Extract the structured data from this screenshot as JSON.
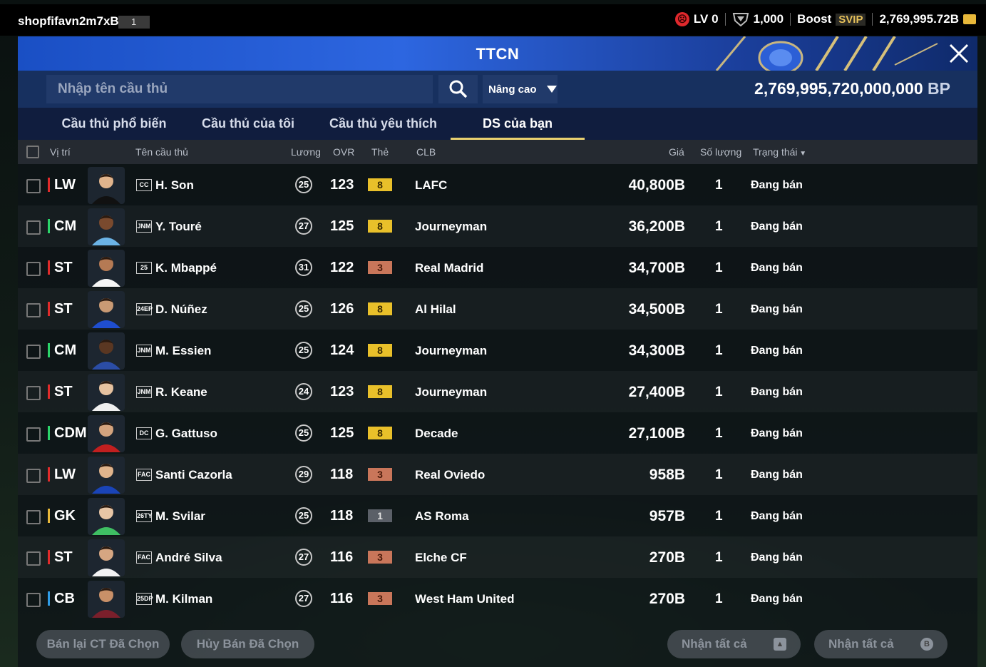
{
  "topbar": {
    "account_name": "shopfifavn2m7xBp",
    "account_badge": "1",
    "level": "LV 0",
    "fc_points": "1,000",
    "boost_label": "Boost",
    "svip_label": "SVIP",
    "bp_short": "2,769,995.72B"
  },
  "window": {
    "title": "TTCN"
  },
  "search": {
    "placeholder": "Nhập tên cầu thủ",
    "advanced_label": "Nâng cao",
    "bp_amount": "2,769,995,720,000,000",
    "bp_unit": "BP"
  },
  "tabs": [
    {
      "label": "Cầu thủ phổ biến",
      "active": false
    },
    {
      "label": "Cầu thủ của tôi",
      "active": false
    },
    {
      "label": "Cầu thủ yêu thích",
      "active": false
    },
    {
      "label": "DS của bạn",
      "active": true
    }
  ],
  "columns": {
    "position": "Vị trí",
    "name": "Tên cầu thủ",
    "salary": "Lương",
    "ovr": "OVR",
    "card": "Thẻ",
    "club": "CLB",
    "price": "Giá",
    "quantity": "Số lượng",
    "status": "Trạng thái"
  },
  "players": [
    {
      "pos": "LW",
      "season": "CC",
      "name": "H. Son",
      "salary": "25",
      "ovr": "123",
      "upgrade": "8",
      "club": "LAFC",
      "price": "40,800B",
      "qty": "1",
      "status": "Đang bán"
    },
    {
      "pos": "CM",
      "season": "JNM",
      "name": "Y. Touré",
      "salary": "27",
      "ovr": "125",
      "upgrade": "8",
      "club": "Journeyman",
      "price": "36,200B",
      "qty": "1",
      "status": "Đang bán"
    },
    {
      "pos": "ST",
      "season": "25",
      "name": "K. Mbappé",
      "salary": "31",
      "ovr": "122",
      "upgrade": "3",
      "club": "Real Madrid",
      "price": "34,700B",
      "qty": "1",
      "status": "Đang bán"
    },
    {
      "pos": "ST",
      "season": "24EP",
      "name": "D. Núñez",
      "salary": "25",
      "ovr": "126",
      "upgrade": "8",
      "club": "Al Hilal",
      "price": "34,500B",
      "qty": "1",
      "status": "Đang bán"
    },
    {
      "pos": "CM",
      "season": "JNM",
      "name": "M. Essien",
      "salary": "25",
      "ovr": "124",
      "upgrade": "8",
      "club": "Journeyman",
      "price": "34,300B",
      "qty": "1",
      "status": "Đang bán"
    },
    {
      "pos": "ST",
      "season": "JNM",
      "name": "R. Keane",
      "salary": "24",
      "ovr": "123",
      "upgrade": "8",
      "club": "Journeyman",
      "price": "27,400B",
      "qty": "1",
      "status": "Đang bán"
    },
    {
      "pos": "CDM",
      "season": "DC",
      "name": "G. Gattuso",
      "salary": "25",
      "ovr": "125",
      "upgrade": "8",
      "club": "Decade",
      "price": "27,100B",
      "qty": "1",
      "status": "Đang bán"
    },
    {
      "pos": "LW",
      "season": "FAC",
      "name": "Santi Cazorla",
      "salary": "29",
      "ovr": "118",
      "upgrade": "3",
      "club": "Real Oviedo",
      "price": "958B",
      "qty": "1",
      "status": "Đang bán"
    },
    {
      "pos": "GK",
      "season": "26TY",
      "name": "M. Svilar",
      "salary": "25",
      "ovr": "118",
      "upgrade": "1",
      "club": "AS Roma",
      "price": "957B",
      "qty": "1",
      "status": "Đang bán"
    },
    {
      "pos": "ST",
      "season": "FAC",
      "name": "André Silva",
      "salary": "27",
      "ovr": "116",
      "upgrade": "3",
      "club": "Elche CF",
      "price": "270B",
      "qty": "1",
      "status": "Đang bán"
    },
    {
      "pos": "CB",
      "season": "25DP",
      "name": "M. Kilman",
      "salary": "27",
      "ovr": "116",
      "upgrade": "3",
      "club": "West Ham United",
      "price": "270B",
      "qty": "1",
      "status": "Đang bán"
    }
  ],
  "footer": {
    "resell_label": "Bán lại CT Đã Chọn",
    "cancel_label": "Hủy Bán Đã Chọn",
    "collect_all_1": "Nhận tất cả",
    "collect_all_2": "Nhận tất cả"
  },
  "colors": {
    "accent_blue": "#1a4fc4",
    "tab_underline": "#e8d070",
    "attacker": "#e02b2b",
    "midfielder": "#2bd46a",
    "goalkeeper": "#e8b83a",
    "defender": "#2f9ce6",
    "upgrade_gold": "#e9c02a",
    "upgrade_bronze": "#c9765a",
    "upgrade_gray": "#5b6068"
  }
}
